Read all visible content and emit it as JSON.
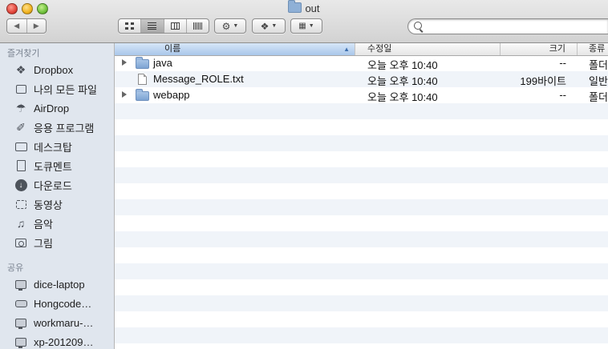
{
  "window": {
    "title": "out"
  },
  "toolbar": {
    "back_icon": "chevron-left-icon",
    "forward_icon": "chevron-right-icon",
    "view_modes": [
      "icon-view",
      "list-view",
      "column-view",
      "coverflow-view"
    ],
    "active_view": "list-view",
    "action_icon": "gear-icon",
    "dropbox_icon": "dropbox-icon",
    "arrange_icon": "arrange-grid-icon",
    "search_placeholder": "",
    "search_value": ""
  },
  "sidebar": {
    "favorites_heading": "즐겨찾기",
    "favorites": [
      {
        "label": "Dropbox",
        "icon": "dropbox-icon"
      },
      {
        "label": "나의 모든 파일",
        "icon": "all-files-icon"
      },
      {
        "label": "AirDrop",
        "icon": "airdrop-icon"
      },
      {
        "label": "응용 프로그램",
        "icon": "applications-icon"
      },
      {
        "label": "데스크탑",
        "icon": "desktop-icon"
      },
      {
        "label": "도큐멘트",
        "icon": "documents-icon"
      },
      {
        "label": "다운로드",
        "icon": "downloads-icon"
      },
      {
        "label": "동영상",
        "icon": "movies-icon"
      },
      {
        "label": "음악",
        "icon": "music-icon"
      },
      {
        "label": "그림",
        "icon": "pictures-icon"
      }
    ],
    "shared_heading": "공유",
    "shared": [
      {
        "label": "dice-laptop",
        "icon": "monitor-icon"
      },
      {
        "label": "Hongcode…",
        "icon": "server-icon"
      },
      {
        "label": "workmaru-…",
        "icon": "monitor-icon"
      },
      {
        "label": "xp-201209…",
        "icon": "monitor-icon"
      }
    ]
  },
  "filelist": {
    "columns": {
      "name": "이름",
      "date": "수정일",
      "size": "크기",
      "kind": "종류"
    },
    "sort_column": "name",
    "rows": [
      {
        "name": "java",
        "date": "오늘 오후 10:40",
        "size": "--",
        "kind": "폴더",
        "type": "folder",
        "expandable": true
      },
      {
        "name": "Message_ROLE.txt",
        "date": "오늘 오후 10:40",
        "size": "199바이트",
        "kind": "일반",
        "type": "file",
        "expandable": false
      },
      {
        "name": "webapp",
        "date": "오늘 오후 10:40",
        "size": "--",
        "kind": "폴더",
        "type": "folder",
        "expandable": true
      }
    ]
  }
}
